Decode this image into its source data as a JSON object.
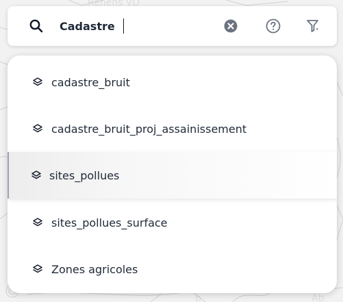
{
  "search": {
    "value": "Cadastre",
    "icons": {
      "search": "search-icon",
      "clear": "clear-circle-icon",
      "help": "help-circle-icon",
      "filter": "filter-dropdown-icon"
    }
  },
  "results": {
    "items": [
      {
        "label": "cadastre_bruit",
        "icon": "layers-icon",
        "active": false
      },
      {
        "label": "cadastre_bruit_proj_assainissement",
        "icon": "layers-icon",
        "active": false
      },
      {
        "label": "sites_pollues",
        "icon": "layers-icon",
        "active": true
      },
      {
        "label": "sites_pollues_surface",
        "icon": "layers-icon",
        "active": false
      },
      {
        "label": "Zones agricoles",
        "icon": "layers-icon",
        "active": false
      }
    ]
  },
  "colors": {
    "text": "#1f2937",
    "icon_gray": "#6b7280",
    "map_lines": "#d6d6d6",
    "active_border": "#9ca3af"
  }
}
